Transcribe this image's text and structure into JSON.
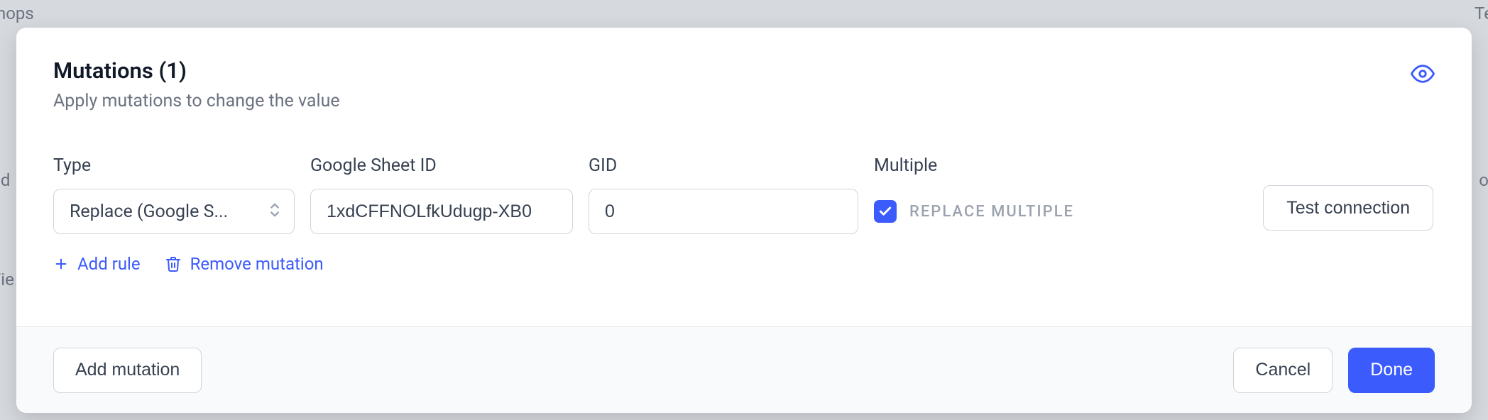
{
  "background": {
    "top_left": "hops",
    "top_right": "Tea",
    "mid_left": "ld",
    "mid_right": "oin",
    "low_left": "Fie"
  },
  "header": {
    "title": "Mutations (1)",
    "subtitle": "Apply mutations to change the value"
  },
  "fields": {
    "type": {
      "label": "Type",
      "value": "Replace (Google S..."
    },
    "sheet_id": {
      "label": "Google Sheet ID",
      "value": "1xdCFFNOLfkUdugp-XB0"
    },
    "gid": {
      "label": "GID",
      "value": "0"
    },
    "multiple": {
      "label": "Multiple",
      "checkbox_label": "REPLACE MULTIPLE",
      "checked": true
    },
    "test_label": "Test connection"
  },
  "row_actions": {
    "add_rule": "Add rule",
    "remove_mutation": "Remove mutation"
  },
  "footer": {
    "add_mutation": "Add mutation",
    "cancel": "Cancel",
    "done": "Done"
  }
}
